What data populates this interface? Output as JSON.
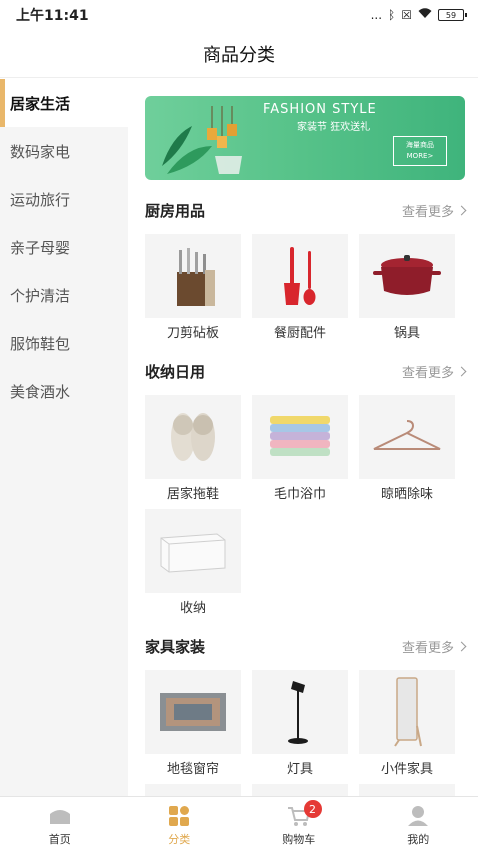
{
  "status_bar": {
    "time": "上午11:41",
    "dots": "...",
    "battery": "59"
  },
  "nav": {
    "title": "商品分类"
  },
  "sidebar": {
    "items": [
      {
        "label": "居家生活",
        "active": true
      },
      {
        "label": "数码家电"
      },
      {
        "label": "运动旅行"
      },
      {
        "label": "亲子母婴"
      },
      {
        "label": "个护清洁"
      },
      {
        "label": "服饰鞋包"
      },
      {
        "label": "美食酒水"
      }
    ]
  },
  "banner": {
    "title": "FASHION STYLE",
    "subtitle": "家装节 狂欢送礼",
    "badge_line1": "海量商品",
    "badge_line2": "MORE>"
  },
  "sections": [
    {
      "title": "厨房用品",
      "more": "查看更多",
      "items": [
        {
          "label": "刀剪砧板",
          "icon": "knife-block-icon"
        },
        {
          "label": "餐厨配件",
          "icon": "spatula-icon"
        },
        {
          "label": "锅具",
          "icon": "pot-icon"
        }
      ]
    },
    {
      "title": "收纳日用",
      "items": [
        {
          "label": "居家拖鞋",
          "icon": "slippers-icon"
        },
        {
          "label": "毛巾浴巾",
          "icon": "towels-icon"
        },
        {
          "label": "晾晒除味",
          "icon": "hanger-icon"
        },
        {
          "label": "收纳",
          "icon": "storage-box-icon"
        }
      ]
    },
    {
      "title": "家具家装",
      "more": "查看更多",
      "items": [
        {
          "label": "地毯窗帘",
          "icon": "rug-icon"
        },
        {
          "label": "灯具",
          "icon": "lamp-icon"
        },
        {
          "label": "小件家具",
          "icon": "mirror-icon"
        }
      ]
    }
  ],
  "tabbar": {
    "items": [
      {
        "label": "首页",
        "icon": "home-icon"
      },
      {
        "label": "分类",
        "icon": "category-icon",
        "active": true
      },
      {
        "label": "购物车",
        "icon": "cart-icon",
        "badge": "2"
      },
      {
        "label": "我的",
        "icon": "profile-icon"
      }
    ]
  },
  "colors": {
    "accent": "#e9b76a",
    "badge": "#e53935",
    "banner": "#58c38a"
  }
}
